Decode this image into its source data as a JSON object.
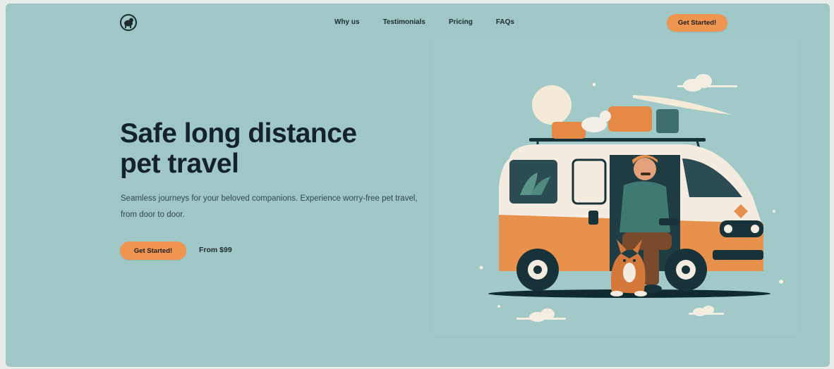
{
  "nav": {
    "logo_icon": "dog-icon",
    "links": [
      "Why us",
      "Testimonials",
      "Pricing",
      "FAQs"
    ],
    "cta_label": "Get Started!"
  },
  "hero": {
    "title_line1": "Safe long distance",
    "title_line2": "pet travel",
    "subtitle": "Seamless journeys for your beloved companions. Experience worry-free pet travel, from door to door.",
    "cta_label": "Get Started!",
    "price": "From $99"
  },
  "illustration": {
    "subject": "van-traveler-with-dog-illustration"
  },
  "colors": {
    "background": "#9fc7c5",
    "accent": "#f09550",
    "text": "#14232a"
  }
}
